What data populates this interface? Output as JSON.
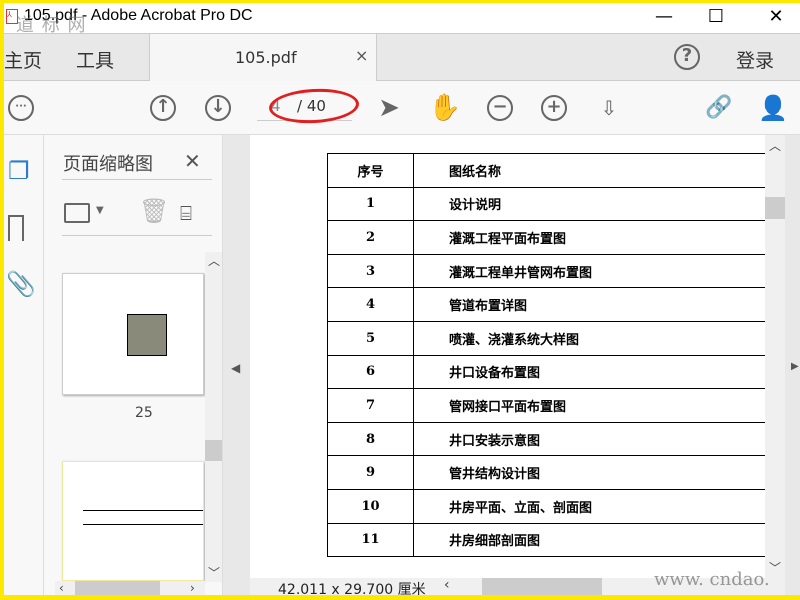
{
  "window": {
    "title": "105.pdf - Adobe Acrobat Pro DC",
    "watermark_top": "道 标 网",
    "minimize": "—",
    "maximize": "☐",
    "close": "✕"
  },
  "tabs": {
    "home": "主页",
    "tools": "工具",
    "document": "105.pdf",
    "document_close": "×",
    "help": "?",
    "login": "登录"
  },
  "toolbar": {
    "current_page": "4",
    "total_pages": "/ 40",
    "annotation_color": "#e02020",
    "active_tool": "hand",
    "active_color": "#2d7bd0"
  },
  "panel": {
    "title": "页面缩略图",
    "close": "✕",
    "thumbnails": [
      {
        "label": "25"
      },
      {
        "label": ""
      }
    ]
  },
  "table": {
    "headers": [
      "序号",
      "图纸名称"
    ],
    "rows": [
      [
        "1",
        "设计说明"
      ],
      [
        "2",
        "灌溉工程平面布置图"
      ],
      [
        "3",
        "灌溉工程单井管网布置图"
      ],
      [
        "4",
        "管道布置详图"
      ],
      [
        "5",
        "喷灌、浇灌系统大样图"
      ],
      [
        "6",
        "井口设备布置图"
      ],
      [
        "7",
        "管网接口平面布置图"
      ],
      [
        "8",
        "井口安装示意图"
      ],
      [
        "9",
        "管井结构设计图"
      ],
      [
        "10",
        "井房平面、立面、剖面图"
      ],
      [
        "11",
        "井房细部剖面图"
      ]
    ]
  },
  "status": {
    "page_size": "42.011 x 29.700 厘米",
    "watermark_bottom": "www. cndao. com"
  }
}
